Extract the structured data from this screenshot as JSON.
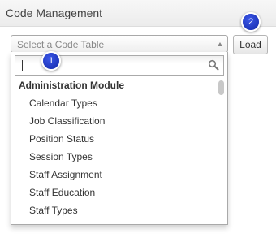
{
  "header": {
    "title": "Code Management"
  },
  "select": {
    "placeholder": "Select a Code Table"
  },
  "load_button": {
    "label": "Load"
  },
  "dropdown": {
    "search_value": "",
    "group": {
      "label": "Administration Module",
      "options": [
        "Calendar Types",
        "Job Classification",
        "Position Status",
        "Session Types",
        "Staff Assignment",
        "Staff Education",
        "Staff Types"
      ]
    }
  },
  "callouts": [
    "1",
    "2"
  ],
  "icons": {
    "select_arrow": "up-arrow-icon",
    "search": "search-icon"
  },
  "colors": {
    "callout_badge": "#1a36c8",
    "header_bg": "#efefef",
    "border": "#a9a9a9"
  }
}
